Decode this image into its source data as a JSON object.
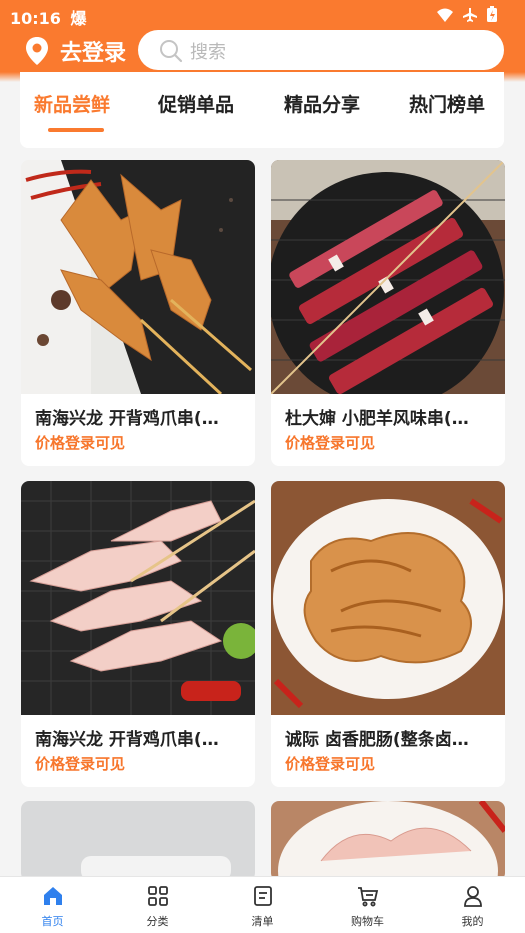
{
  "status_bar": {
    "time": "10:16",
    "carrier_glyph": "爆"
  },
  "header": {
    "login_label": "去登录",
    "search_placeholder": "搜索"
  },
  "tabs": [
    {
      "label": "新品尝鲜",
      "active": true
    },
    {
      "label": "促销单品",
      "active": false
    },
    {
      "label": "精品分享",
      "active": false
    },
    {
      "label": "热门榜单",
      "active": false
    }
  ],
  "products": [
    {
      "title": "南海兴龙 开背鸡爪串(…",
      "price_text": "价格登录可见",
      "image": "chicken-feet-skewers-marinated"
    },
    {
      "title": "杜大婶 小肥羊风味串(…",
      "price_text": "价格登录可见",
      "image": "lamb-skewers-on-grill"
    },
    {
      "title": "南海兴龙 开背鸡爪串(…",
      "price_text": "价格登录可见",
      "image": "chicken-feet-skewers-raw"
    },
    {
      "title": "诚际 卤香肥肠(整条卤…",
      "price_text": "价格登录可见",
      "image": "braised-intestines-plate"
    }
  ],
  "bottom_nav": [
    {
      "label": "首页",
      "icon": "home-icon",
      "active": true
    },
    {
      "label": "分类",
      "icon": "grid-icon",
      "active": false
    },
    {
      "label": "清单",
      "icon": "list-icon",
      "active": false
    },
    {
      "label": "购物车",
      "icon": "cart-icon",
      "active": false
    },
    {
      "label": "我的",
      "icon": "user-icon",
      "active": false
    }
  ],
  "colors": {
    "brand": "#fa7a2f",
    "price": "#f7762c",
    "nav_active": "#2f80ed"
  }
}
